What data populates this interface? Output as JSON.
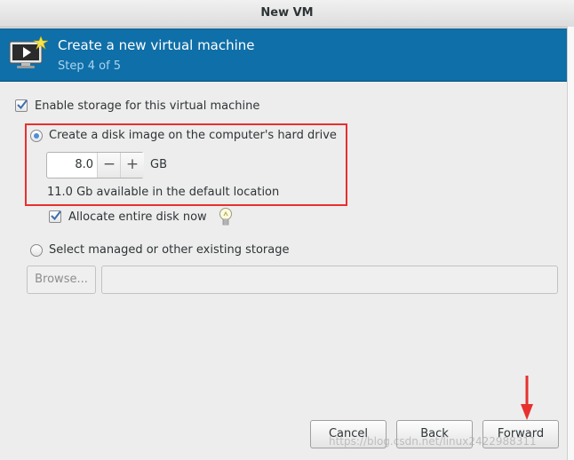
{
  "window": {
    "title": "New VM"
  },
  "header": {
    "title": "Create a new virtual machine",
    "step": "Step 4 of 5",
    "icon": "vm-monitor-icon",
    "color": "#0f6fa8"
  },
  "storage": {
    "enable_label": "Enable storage for this virtual machine",
    "enable_checked": true,
    "create_disk_label": "Create a disk image on the computer's hard drive",
    "create_disk_selected": true,
    "disk_size": "8.0",
    "minus_label": "−",
    "plus_label": "+",
    "unit": "GB",
    "available_text": "11.0 Gb available in the default location",
    "allocate_label": "Allocate entire disk now",
    "allocate_checked": true,
    "managed_label": "Select managed or other existing storage",
    "managed_selected": false,
    "browse_label": "Browse...",
    "path_value": ""
  },
  "buttons": {
    "cancel": "Cancel",
    "back": "Back",
    "forward": "Forward"
  },
  "annotations": {
    "highlight_color": "#e8302f"
  },
  "watermark": "https://blog.csdn.net/linux2422988311"
}
